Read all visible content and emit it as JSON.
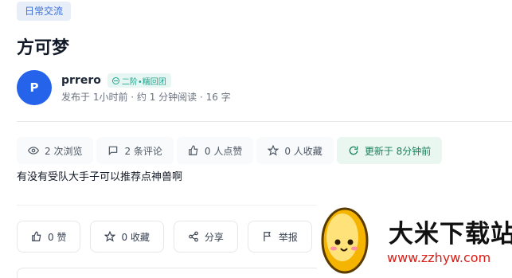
{
  "post": {
    "category_tag": "日常交流",
    "title": "方可梦",
    "content": "有没有受队大手子可以推荐点神兽啊"
  },
  "author": {
    "avatar_letter": "P",
    "username": "prrero",
    "level_badge": "二阶•糯回团",
    "meta": "发布于 1小时前 · 约 1 分钟阅读 · 16 字"
  },
  "stats": {
    "views": "2 次浏览",
    "comments": "2 条评论",
    "likes": "0 人点赞",
    "favorites": "0 人收藏",
    "updated": "更新于 8分钟前"
  },
  "actions": {
    "like": "0 赞",
    "favorite": "0 收藏",
    "share": "分享",
    "report": "举报"
  },
  "watermark": {
    "title": "大米下载站",
    "url": "www.zzhyw.com"
  },
  "colors": {
    "accent": "#2563eb",
    "tag_text": "#3b6fd6",
    "badge_green": "#20a58e",
    "watermark_red": "#d91e18"
  },
  "icons": [
    "eye-icon",
    "comment-icon",
    "thumb-up-icon",
    "star-icon",
    "refresh-icon",
    "share-icon",
    "flag-icon"
  ]
}
